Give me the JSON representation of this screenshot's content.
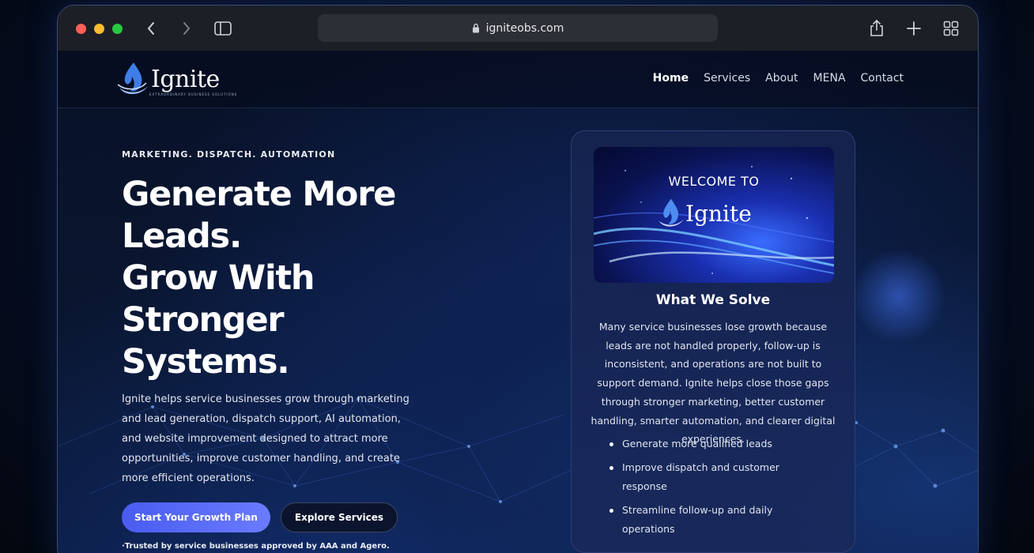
{
  "browser": {
    "url": "igniteobs.com"
  },
  "header": {
    "logo_text": "Ignite",
    "logo_tagline": "EXTRAORDINARY BUSINESS SOLUTIONS",
    "nav": [
      {
        "label": "Home",
        "active": true
      },
      {
        "label": "Services"
      },
      {
        "label": "About"
      },
      {
        "label": "MENA"
      },
      {
        "label": "Contact"
      }
    ]
  },
  "hero": {
    "eyebrow": "MARKETING. DISPATCH. AUTOMATION",
    "headline_lines": [
      "Generate More",
      "Leads.",
      "Grow With",
      "Stronger",
      "Systems."
    ],
    "description": "Ignite helps service businesses grow through marketing and lead generation, dispatch support, AI automation, and website improvement designed to attract more opportunities, improve customer handling, and create more efficient operations.",
    "primary_cta": "Start Your Growth Plan",
    "secondary_cta": "Explore Services",
    "trusted": "·Trusted by service businesses approved by AAA and Agero."
  },
  "card": {
    "image_welcome": "WELCOME TO",
    "image_logo": "Ignite",
    "title": "What We Solve",
    "text": "Many service businesses lose growth because leads are not handled properly, follow-up is inconsistent, and operations are not built to support demand. Ignite helps close those gaps through stronger marketing, better customer handling, smarter automation, and clearer digital experiences.",
    "bullets": [
      "Generate more qualified leads",
      "Improve dispatch and customer response",
      "Streamline follow-up and daily operations"
    ]
  },
  "colors": {
    "accent": "#5a6cf8",
    "background": "#081229"
  }
}
